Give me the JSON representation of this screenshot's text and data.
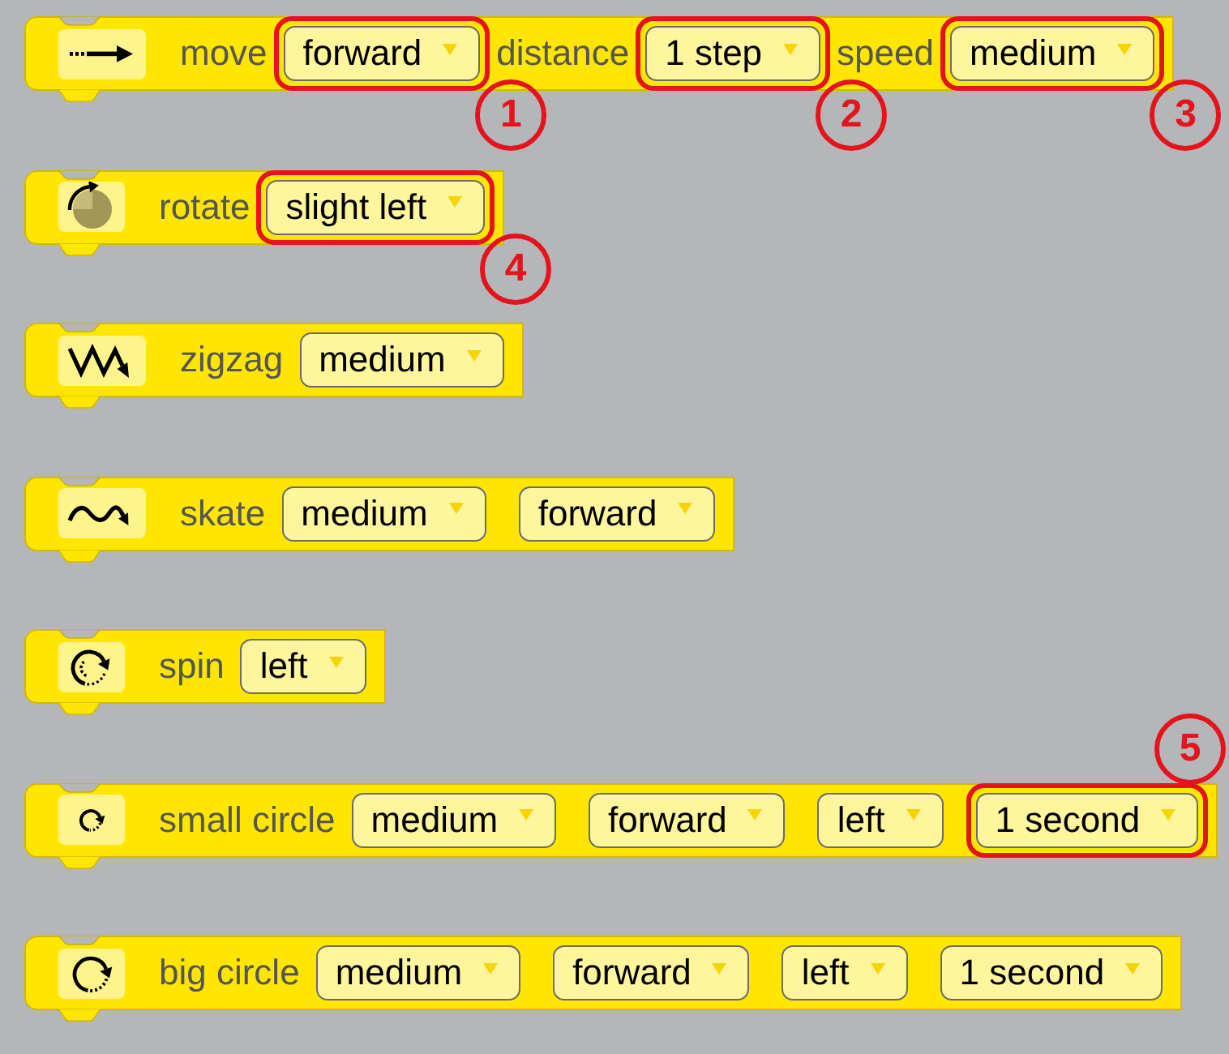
{
  "blocks": [
    {
      "kind": "move",
      "parts": [
        {
          "kind": "label",
          "text": "move"
        },
        {
          "kind": "dropdown",
          "value": "forward",
          "callout": {
            "number": "1",
            "above": false
          }
        },
        {
          "kind": "label",
          "text": "distance"
        },
        {
          "kind": "dropdown",
          "value": "1 step",
          "callout": {
            "number": "2",
            "above": false
          }
        },
        {
          "kind": "label",
          "text": "speed"
        },
        {
          "kind": "dropdown",
          "value": "medium",
          "callout": {
            "number": "3",
            "above": false
          }
        }
      ]
    },
    {
      "kind": "rotate",
      "parts": [
        {
          "kind": "label",
          "text": "rotate"
        },
        {
          "kind": "dropdown",
          "value": "slight left",
          "callout": {
            "number": "4",
            "above": false
          }
        }
      ]
    },
    {
      "kind": "zigzag",
      "parts": [
        {
          "kind": "label",
          "text": "zigzag"
        },
        {
          "kind": "dropdown",
          "value": "medium"
        }
      ]
    },
    {
      "kind": "skate",
      "parts": [
        {
          "kind": "label",
          "text": "skate"
        },
        {
          "kind": "dropdown",
          "value": "medium"
        },
        {
          "kind": "dropdown",
          "value": "forward"
        }
      ]
    },
    {
      "kind": "spin",
      "parts": [
        {
          "kind": "label",
          "text": "spin"
        },
        {
          "kind": "dropdown",
          "value": "left"
        }
      ]
    },
    {
      "kind": "small_circle",
      "parts": [
        {
          "kind": "label",
          "text": "small circle"
        },
        {
          "kind": "dropdown",
          "value": "medium"
        },
        {
          "kind": "dropdown",
          "value": "forward"
        },
        {
          "kind": "dropdown",
          "value": "left"
        },
        {
          "kind": "dropdown",
          "value": "1 second",
          "callout": {
            "number": "5",
            "above": true
          }
        }
      ]
    },
    {
      "kind": "big_circle",
      "parts": [
        {
          "kind": "label",
          "text": "big circle"
        },
        {
          "kind": "dropdown",
          "value": "medium"
        },
        {
          "kind": "dropdown",
          "value": "forward"
        },
        {
          "kind": "dropdown",
          "value": "left"
        },
        {
          "kind": "dropdown",
          "value": "1 second"
        }
      ]
    }
  ]
}
